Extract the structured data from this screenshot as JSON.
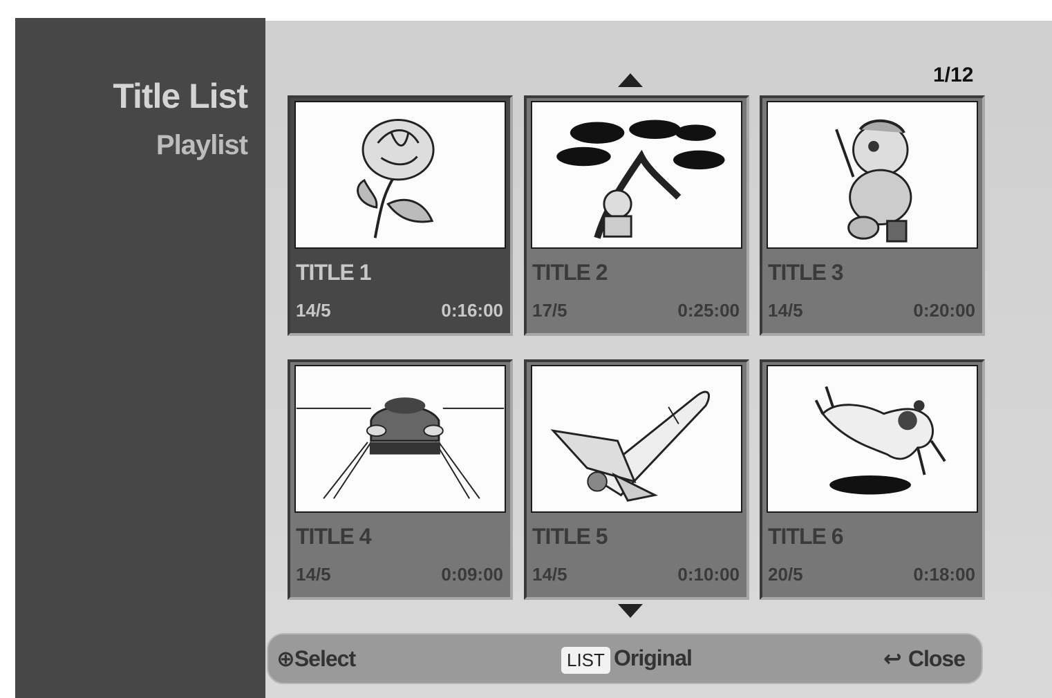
{
  "sidebar": {
    "title": "Title List",
    "subtitle": "Playlist"
  },
  "page_counter": "1/12",
  "titles": [
    {
      "label": "TITLE 1",
      "date": "14/5",
      "duration": "0:16:00",
      "thumbnail": "rose",
      "selected": true
    },
    {
      "label": "TITLE 2",
      "date": "17/5",
      "duration": "0:25:00",
      "thumbnail": "tree"
    },
    {
      "label": "TITLE 3",
      "date": "14/5",
      "duration": "0:20:00",
      "thumbnail": "bear"
    },
    {
      "label": "TITLE 4",
      "date": "14/5",
      "duration": "0:09:00",
      "thumbnail": "car"
    },
    {
      "label": "TITLE 5",
      "date": "14/5",
      "duration": "0:10:00",
      "thumbnail": "space-shuttle"
    },
    {
      "label": "TITLE 6",
      "date": "20/5",
      "duration": "0:18:00",
      "thumbnail": "dog"
    }
  ],
  "bottom_bar": {
    "select_label": "Select",
    "list_key": "LIST",
    "original_label": "Original",
    "close_label": "Close"
  }
}
